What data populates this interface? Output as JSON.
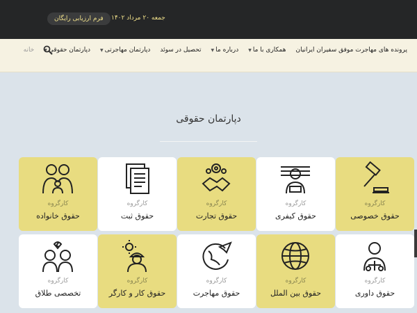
{
  "topbar": {
    "date": "جمعه ۲۰ مرداد ۱۴۰۲",
    "eval_button": "فرم ارزیابی رایگان"
  },
  "nav": {
    "items": [
      {
        "label": "خانه",
        "caret": false
      },
      {
        "label": "دپارتمان حقوقی",
        "caret": true
      },
      {
        "label": "دپارتمان مهاجرتی",
        "caret": true
      },
      {
        "label": "تحصیل در سوئد",
        "caret": false
      },
      {
        "label": "درباره ما",
        "caret": true
      },
      {
        "label": "همکاری با ما",
        "caret": true
      },
      {
        "label": "پرونده های مهاجرت موفق سفیران ایرانیان",
        "caret": false
      }
    ],
    "search_icon": "search-icon"
  },
  "section": {
    "title": "دپارتمان حقوقی"
  },
  "cards": [
    {
      "sub": "کارگروه",
      "name": "حقوق خصوصی",
      "icon": "gavel-icon",
      "color": "yellow"
    },
    {
      "sub": "کارگروه",
      "name": "حقوق کیفری",
      "icon": "prisoner-icon",
      "color": "white"
    },
    {
      "sub": "کارگروه",
      "name": "حقوق تجارت",
      "icon": "handshake-icon",
      "color": "yellow"
    },
    {
      "sub": "کارگروه",
      "name": "حقوق ثبت",
      "icon": "document-icon",
      "color": "white"
    },
    {
      "sub": "کارگروه",
      "name": "حقوق خانواده",
      "icon": "family-icon",
      "color": "yellow"
    },
    {
      "sub": "کارگروه",
      "name": "حقوق داوری",
      "icon": "judge-icon",
      "color": "white"
    },
    {
      "sub": "کارگروه",
      "name": "حقوق بین الملل",
      "icon": "globe-icon",
      "color": "yellow"
    },
    {
      "sub": "کارگروه",
      "name": "حقوق مهاجرت",
      "icon": "plane-globe-icon",
      "color": "white"
    },
    {
      "sub": "کارگروه",
      "name": "حقوق کار و کارگر",
      "icon": "worker-icon",
      "color": "yellow"
    },
    {
      "sub": "کارگروه",
      "name": "تخصصی طلاق",
      "icon": "divorce-icon",
      "color": "white"
    }
  ],
  "colors": {
    "topbar": "#252627",
    "accent": "#f0e08a",
    "card_yellow": "#e8dc80",
    "nav_bg": "#f6f2e2",
    "page_bg": "#dbe3ea"
  }
}
